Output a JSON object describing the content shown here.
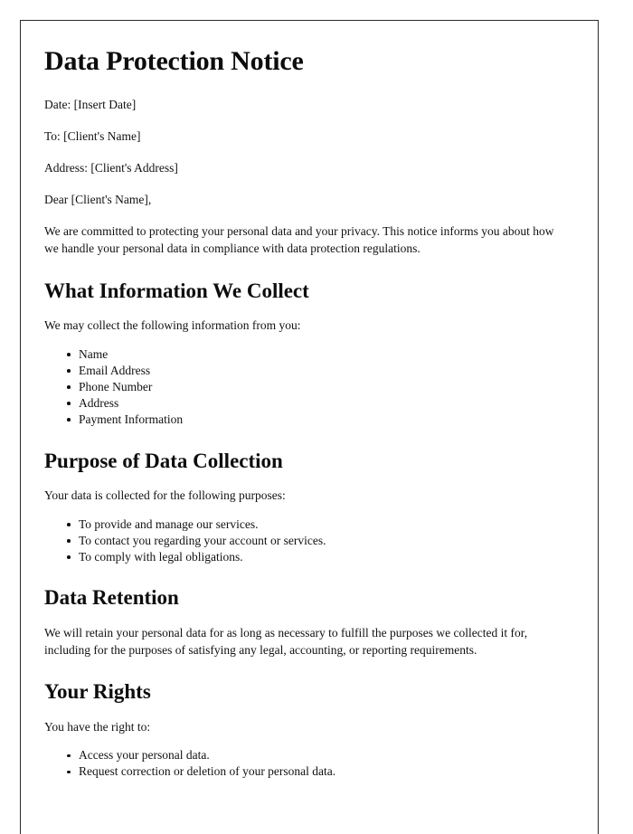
{
  "document": {
    "title": "Data Protection Notice",
    "meta": [
      {
        "label": "Date:",
        "value": "[Insert Date]",
        "full": "Date: [Insert Date]"
      },
      {
        "label": "To:",
        "value": "[Client's Name]",
        "full": "To: [Client's Name]"
      },
      {
        "label": "Address:",
        "value": "[Client's Address]",
        "full": "Address: [Client's Address]"
      }
    ],
    "salutation": "Dear [Client's Name],",
    "intro_paragraph": "We are committed to protecting your personal data and your privacy. This notice informs you about how we handle your personal data in compliance with data protection regulations.",
    "sections": [
      {
        "heading": "What Information We Collect",
        "lead_in": "We may collect the following information from you:",
        "bullets": [
          "Name",
          "Email Address",
          "Phone Number",
          "Address",
          "Payment Information"
        ]
      },
      {
        "heading": "Purpose of Data Collection",
        "lead_in": "Your data is collected for the following purposes:",
        "bullets": [
          "To provide and manage our services.",
          "To contact you regarding your account or services.",
          "To comply with legal obligations."
        ]
      },
      {
        "heading": "Data Retention",
        "paragraph": "We will retain your personal data for as long as necessary to fulfill the purposes we collected it for, including for the purposes of satisfying any legal, accounting, or reporting requirements."
      },
      {
        "heading": "Your Rights",
        "lead_in": "You have the right to:",
        "bullets": [
          "Access your personal data.",
          "Request correction or deletion of your personal data."
        ]
      }
    ]
  },
  "colors": {
    "page_background": "#ffffff",
    "text": "#111111",
    "heading": "#0d0d0d",
    "page_border": "#2b2b2b"
  }
}
